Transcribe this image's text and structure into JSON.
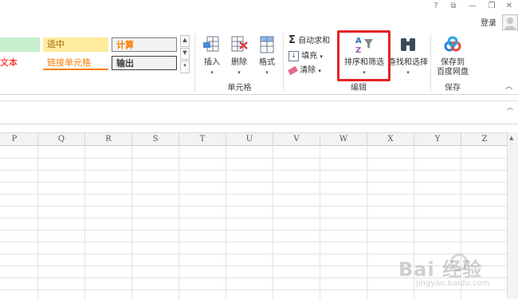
{
  "window": {
    "help": "?",
    "restore_ribbon": "⧉",
    "minimize": "—",
    "maximize": "❐",
    "close": "✕",
    "login_label": "登录"
  },
  "styles": {
    "text_partial": "文本",
    "neutral": "适中",
    "hyperlink": "链接单元格",
    "calculation": "计算",
    "output": "输出",
    "colors": {
      "good_bg": "#c6efce",
      "neutral_bg": "#ffeb9c",
      "neutral_text": "#9c6500",
      "link_text": "#fa7d00",
      "warn_text": "#ff0000",
      "calc_bg": "#f2f2f2",
      "calc_text": "#fa7d00"
    }
  },
  "cells_group": {
    "label": "单元格",
    "insert": "插入",
    "delete": "删除",
    "format": "格式"
  },
  "editing_group": {
    "label": "编辑",
    "autosum": "自动求和",
    "fill": "填充",
    "clear": "清除",
    "sort_filter": "排序和筛选",
    "find_select": "查找和选择"
  },
  "save_group": {
    "label": "保存",
    "save_line1": "保存到",
    "save_line2": "百度网盘"
  },
  "collapse_ribbon": "︿",
  "formula_bar": {
    "expand": "︿"
  },
  "columns": [
    "P",
    "Q",
    "R",
    "S",
    "T",
    "U",
    "V",
    "W",
    "X",
    "Y",
    "Z"
  ],
  "watermark": {
    "brand": "Bai 经验",
    "url": "jingyan.baidu.com"
  }
}
